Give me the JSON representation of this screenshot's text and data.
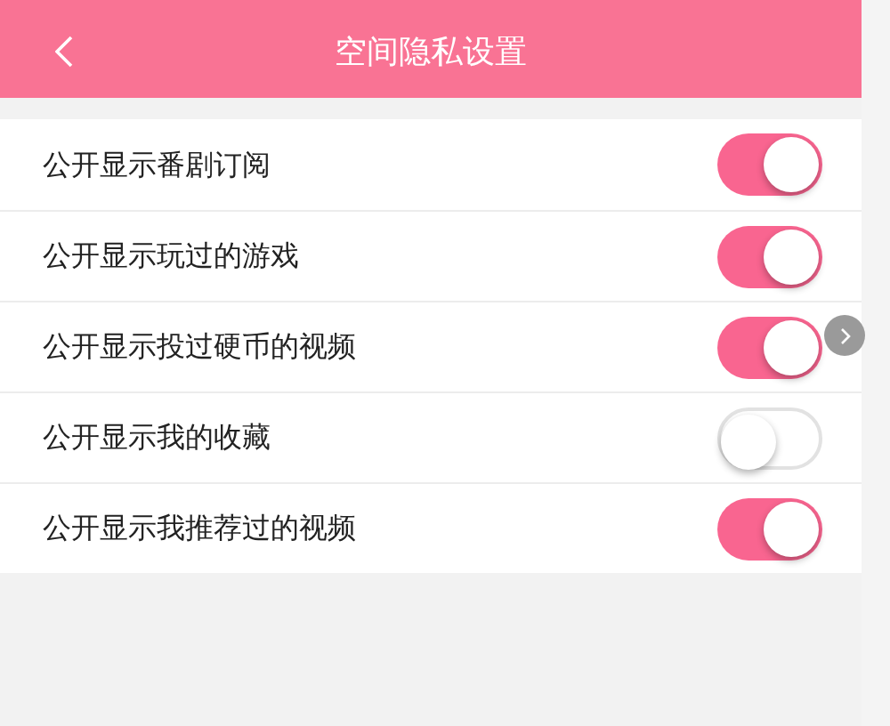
{
  "header": {
    "title": "空间隐私设置"
  },
  "settings": [
    {
      "label": "公开显示番剧订阅",
      "on": true
    },
    {
      "label": "公开显示玩过的游戏",
      "on": true
    },
    {
      "label": "公开显示投过硬币的视频",
      "on": true
    },
    {
      "label": "公开显示我的收藏",
      "on": false
    },
    {
      "label": "公开显示我推荐过的视频",
      "on": true
    }
  ]
}
